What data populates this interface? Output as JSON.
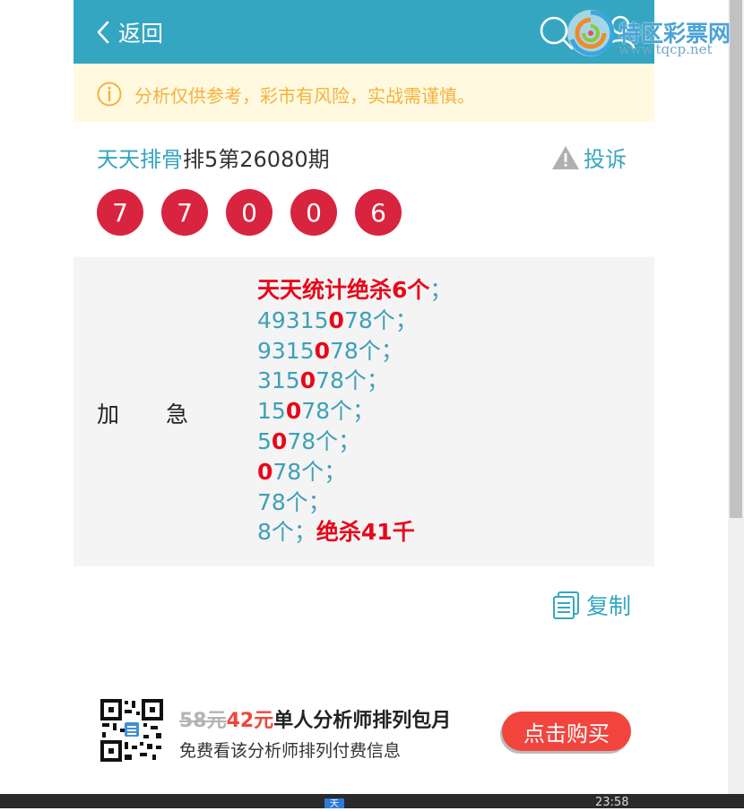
{
  "header": {
    "back_label": "返回"
  },
  "watermark": {
    "title": "特区彩票网",
    "url": "www.tqcp.net"
  },
  "notice": {
    "text": "分析仅供参考，彩市有风险，实战需谨慎。"
  },
  "issue": {
    "analyst": "天天排骨",
    "title_rest": "排5第26080期",
    "complain_label": "投诉"
  },
  "balls": [
    "7",
    "7",
    "0",
    "0",
    "6"
  ],
  "analysis": {
    "label_a": "加",
    "label_b": "急",
    "headline": "天天统计绝杀6个",
    "headline_sep": "；",
    "lines": [
      {
        "pre": "49315",
        "hl": "0",
        "post": "78个；"
      },
      {
        "pre": "9315",
        "hl": "0",
        "post": "78个；"
      },
      {
        "pre": "315",
        "hl": "0",
        "post": "78个；"
      },
      {
        "pre": "15",
        "hl": "0",
        "post": "78个；"
      },
      {
        "pre": "5",
        "hl": "0",
        "post": "78个；"
      },
      {
        "pre": "",
        "hl": "0",
        "post": "78个；"
      },
      {
        "pre": "78个；",
        "hl": "",
        "post": ""
      }
    ],
    "last_pre": "8个；",
    "last_hl": "绝杀41千"
  },
  "copy_label": "复制",
  "promo": {
    "old_price": "58元",
    "new_price": "42元",
    "title": "单人分析师排列包月",
    "subtitle": "免费看该分析师排列付费信息",
    "buy_label": "点击购买"
  },
  "taskbar": {
    "app_glyph": "天",
    "clock": "23:58"
  },
  "colors": {
    "header": "#35a6c2",
    "ball": "#d9243f",
    "highlight": "#e8071a",
    "notice_text": "#f5b23c",
    "buy": "#f1453d"
  }
}
